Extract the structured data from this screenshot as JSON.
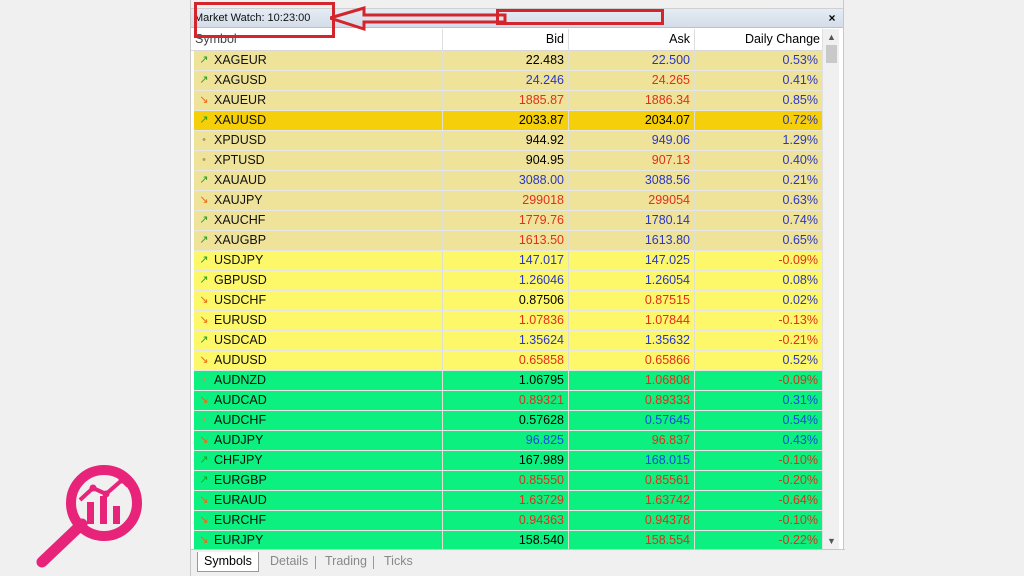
{
  "window": {
    "title": "Market Watch: 10:23:00",
    "close_glyph": "×"
  },
  "columns": {
    "symbol": "Symbol",
    "bid": "Bid",
    "ask": "Ask",
    "change": "Daily Change"
  },
  "rows": [
    {
      "symbol": "XAGEUR",
      "bid": "22.483",
      "ask": "22.500",
      "change": "0.53%",
      "dir": "up",
      "bg": "#efe39a",
      "bid_color": "#000000",
      "ask_color": "#2a36c8",
      "chg_color": "#2a36c8"
    },
    {
      "symbol": "XAGUSD",
      "bid": "24.246",
      "ask": "24.265",
      "change": "0.41%",
      "dir": "up",
      "bg": "#efe39a",
      "bid_color": "#2a36c8",
      "ask_color": "#e0301e",
      "chg_color": "#2a36c8"
    },
    {
      "symbol": "XAUEUR",
      "bid": "1885.87",
      "ask": "1886.34",
      "change": "0.85%",
      "dir": "down",
      "bg": "#efe39a",
      "bid_color": "#e0301e",
      "ask_color": "#e0301e",
      "chg_color": "#2a36c8"
    },
    {
      "symbol": "XAUUSD",
      "bid": "2033.87",
      "ask": "2034.07",
      "change": "0.72%",
      "dir": "up",
      "bg": "#f5cf0a",
      "bid_color": "#000000",
      "ask_color": "#000000",
      "chg_color": "#2a36c8"
    },
    {
      "symbol": "XPDUSD",
      "bid": "944.92",
      "ask": "949.06",
      "change": "1.29%",
      "dir": "none",
      "bg": "#efe39a",
      "bid_color": "#000000",
      "ask_color": "#2a36c8",
      "chg_color": "#2a36c8"
    },
    {
      "symbol": "XPTUSD",
      "bid": "904.95",
      "ask": "907.13",
      "change": "0.40%",
      "dir": "none",
      "bg": "#efe39a",
      "bid_color": "#000000",
      "ask_color": "#e0301e",
      "chg_color": "#2a36c8"
    },
    {
      "symbol": "XAUAUD",
      "bid": "3088.00",
      "ask": "3088.56",
      "change": "0.21%",
      "dir": "up",
      "bg": "#efe39a",
      "bid_color": "#2a36c8",
      "ask_color": "#2a36c8",
      "chg_color": "#2a36c8"
    },
    {
      "symbol": "XAUJPY",
      "bid": "299018",
      "ask": "299054",
      "change": "0.63%",
      "dir": "down",
      "bg": "#efe39a",
      "bid_color": "#e0301e",
      "ask_color": "#e0301e",
      "chg_color": "#2a36c8"
    },
    {
      "symbol": "XAUCHF",
      "bid": "1779.76",
      "ask": "1780.14",
      "change": "0.74%",
      "dir": "up",
      "bg": "#efe39a",
      "bid_color": "#e0301e",
      "ask_color": "#2a36c8",
      "chg_color": "#2a36c8"
    },
    {
      "symbol": "XAUGBP",
      "bid": "1613.50",
      "ask": "1613.80",
      "change": "0.65%",
      "dir": "up",
      "bg": "#efe39a",
      "bid_color": "#e0301e",
      "ask_color": "#2a36c8",
      "chg_color": "#2a36c8"
    },
    {
      "symbol": "USDJPY",
      "bid": "147.017",
      "ask": "147.025",
      "change": "-0.09%",
      "dir": "up",
      "bg": "#fdf76a",
      "bid_color": "#2a36c8",
      "ask_color": "#2a36c8",
      "chg_color": "#e0301e"
    },
    {
      "symbol": "GBPUSD",
      "bid": "1.26046",
      "ask": "1.26054",
      "change": "0.08%",
      "dir": "up",
      "bg": "#fdf76a",
      "bid_color": "#2a36c8",
      "ask_color": "#2a36c8",
      "chg_color": "#2a36c8"
    },
    {
      "symbol": "USDCHF",
      "bid": "0.87506",
      "ask": "0.87515",
      "change": "0.02%",
      "dir": "down",
      "bg": "#fdf76a",
      "bid_color": "#000000",
      "ask_color": "#e0301e",
      "chg_color": "#2a36c8"
    },
    {
      "symbol": "EURUSD",
      "bid": "1.07836",
      "ask": "1.07844",
      "change": "-0.13%",
      "dir": "down",
      "bg": "#fdf76a",
      "bid_color": "#e0301e",
      "ask_color": "#e0301e",
      "chg_color": "#e0301e"
    },
    {
      "symbol": "USDCAD",
      "bid": "1.35624",
      "ask": "1.35632",
      "change": "-0.21%",
      "dir": "up",
      "bg": "#fdf76a",
      "bid_color": "#2a36c8",
      "ask_color": "#2a36c8",
      "chg_color": "#e0301e"
    },
    {
      "symbol": "AUDUSD",
      "bid": "0.65858",
      "ask": "0.65866",
      "change": "0.52%",
      "dir": "down",
      "bg": "#fdf76a",
      "bid_color": "#e0301e",
      "ask_color": "#e0301e",
      "chg_color": "#2a36c8"
    },
    {
      "symbol": "AUDNZD",
      "bid": "1.06795",
      "ask": "1.06808",
      "change": "-0.09%",
      "dir": "none",
      "bg": "#0bf07e",
      "bid_color": "#000000",
      "ask_color": "#e0301e",
      "chg_color": "#e0301e"
    },
    {
      "symbol": "AUDCAD",
      "bid": "0.89321",
      "ask": "0.89333",
      "change": "0.31%",
      "dir": "down",
      "bg": "#0bf07e",
      "bid_color": "#e0301e",
      "ask_color": "#e0301e",
      "chg_color": "#1b4cd8"
    },
    {
      "symbol": "AUDCHF",
      "bid": "0.57628",
      "ask": "0.57645",
      "change": "0.54%",
      "dir": "none",
      "bg": "#0bf07e",
      "bid_color": "#000000",
      "ask_color": "#1b4cd8",
      "chg_color": "#1b4cd8"
    },
    {
      "symbol": "AUDJPY",
      "bid": "96.825",
      "ask": "96.837",
      "change": "0.43%",
      "dir": "down",
      "bg": "#0bf07e",
      "bid_color": "#1b4cd8",
      "ask_color": "#e0301e",
      "chg_color": "#1b4cd8"
    },
    {
      "symbol": "CHFJPY",
      "bid": "167.989",
      "ask": "168.015",
      "change": "-0.10%",
      "dir": "up",
      "bg": "#0bf07e",
      "bid_color": "#000000",
      "ask_color": "#1b4cd8",
      "chg_color": "#e0301e"
    },
    {
      "symbol": "EURGBP",
      "bid": "0.85550",
      "ask": "0.85561",
      "change": "-0.20%",
      "dir": "up",
      "bg": "#0bf07e",
      "bid_color": "#e0301e",
      "ask_color": "#e0301e",
      "chg_color": "#e0301e"
    },
    {
      "symbol": "EURAUD",
      "bid": "1.63729",
      "ask": "1.63742",
      "change": "-0.64%",
      "dir": "down",
      "bg": "#0bf07e",
      "bid_color": "#e0301e",
      "ask_color": "#e0301e",
      "chg_color": "#e0301e"
    },
    {
      "symbol": "EURCHF",
      "bid": "0.94363",
      "ask": "0.94378",
      "change": "-0.10%",
      "dir": "down",
      "bg": "#0bf07e",
      "bid_color": "#e0301e",
      "ask_color": "#e0301e",
      "chg_color": "#e0301e"
    },
    {
      "symbol": "EURJPY",
      "bid": "158.540",
      "ask": "158.554",
      "change": "-0.22%",
      "dir": "down",
      "bg": "#0bf07e",
      "bid_color": "#000000",
      "ask_color": "#e0301e",
      "chg_color": "#e0301e"
    }
  ],
  "arrow_glyphs": {
    "up": "↗",
    "down": "↘",
    "none": "•"
  },
  "arrow_colors": {
    "up": "#1fa31f",
    "down": "#e86a10",
    "none": "#b0a060"
  },
  "tabs": [
    {
      "label": "Symbols",
      "active": true
    },
    {
      "label": "Details",
      "active": false
    },
    {
      "label": "Trading",
      "active": false
    },
    {
      "label": "Ticks",
      "active": false
    }
  ],
  "scrollbar": {
    "up_glyph": "▲",
    "down_glyph": "▼"
  },
  "colors": {
    "annotation": "#d4242c",
    "logo": "#e8247a"
  }
}
